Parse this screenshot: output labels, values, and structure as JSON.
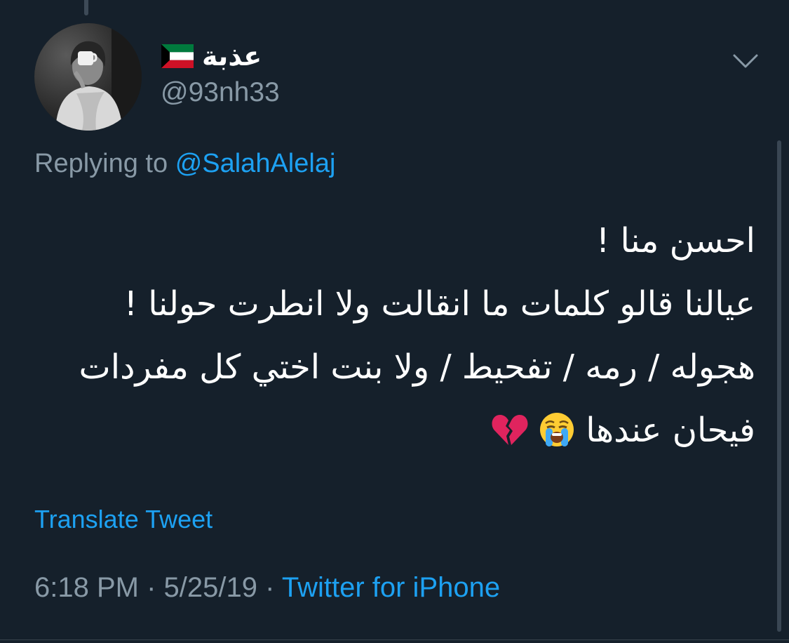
{
  "colors": {
    "background": "#15202b",
    "primary_text": "#ffffff",
    "secondary_text": "#8899a6",
    "accent": "#1da1f2"
  },
  "header": {
    "display_name": "عذبة",
    "flag_icon": "kuwait-flag-icon",
    "handle": "@93nh33",
    "caret_icon": "chevron-down-icon"
  },
  "reply": {
    "prefix": "Replying to",
    "mention": "@SalahAlelaj"
  },
  "tweet": {
    "lines": [
      "احسن منا !",
      "عيالنا قالو كلمات ما انقالت ولا انطرت حولنا !",
      "هجوله / رمه / تفحيط / ولا بنت اختي كل مفردات",
      "فيحان عندها"
    ],
    "emojis": [
      "crying-face-icon",
      "broken-heart-icon"
    ]
  },
  "translate_label": "Translate Tweet",
  "meta": {
    "time": "6:18 PM",
    "separator": "·",
    "date": "5/25/19",
    "source": "Twitter for iPhone"
  }
}
